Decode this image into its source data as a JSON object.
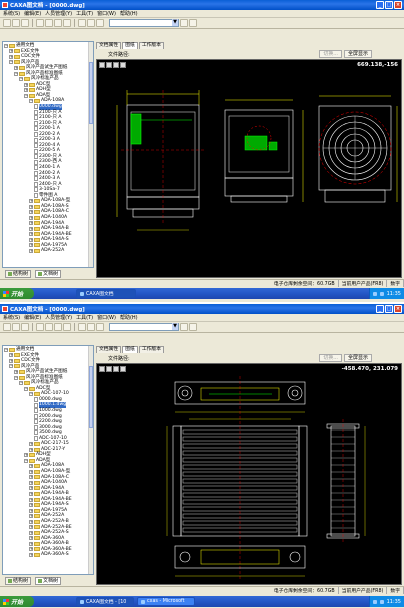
{
  "window1": {
    "title": "CAXA图文档 - [0000.dwg]",
    "menus": [
      "系统(S)",
      "编辑(E)",
      "人员管理(Y)",
      "工具(T)",
      "窗口(W)",
      "帮助(H)"
    ],
    "doc_tabs": [
      "文档属性",
      "图纸",
      "工作版本"
    ],
    "path_label": "文件路径:",
    "disabled_button": "切换...",
    "fullscreen_button": "全屏显示",
    "coordinate": "669.138,-156",
    "tree": [
      {
        "t": "通用文档",
        "d": 0,
        "k": "fold",
        "pm": "-"
      },
      {
        "t": "EXE文件",
        "d": 1,
        "k": "fold",
        "pm": "+"
      },
      {
        "t": "CDC文件",
        "d": 1,
        "k": "fold",
        "pm": "+"
      },
      {
        "t": "风冷产品",
        "d": 1,
        "k": "fold",
        "pm": "-"
      },
      {
        "t": "风冷产品试生产图纸",
        "d": 2,
        "k": "fold",
        "pm": "+"
      },
      {
        "t": "风冷产品标准图纸",
        "d": 2,
        "k": "fold",
        "pm": "-"
      },
      {
        "t": "风冷标准产品",
        "d": 3,
        "k": "fold",
        "pm": "-"
      },
      {
        "t": "ADC型",
        "d": 4,
        "k": "fold",
        "pm": "+"
      },
      {
        "t": "ADH型",
        "d": 4,
        "k": "fold",
        "pm": "+"
      },
      {
        "t": "ADA型",
        "d": 4,
        "k": "fold",
        "pm": "-"
      },
      {
        "t": "ADA-108A",
        "d": 5,
        "k": "fold",
        "pm": "-"
      },
      {
        "t": "0000.dwg",
        "d": 6,
        "k": "file",
        "sel": true
      },
      {
        "t": "2100-只 A",
        "d": 6,
        "k": "file"
      },
      {
        "t": "2100-只 A",
        "d": 6,
        "k": "file"
      },
      {
        "t": "2100-只 A",
        "d": 6,
        "k": "file"
      },
      {
        "t": "2200-1 A",
        "d": 6,
        "k": "file"
      },
      {
        "t": "2200-2 A",
        "d": 6,
        "k": "file"
      },
      {
        "t": "2200-3 A",
        "d": 6,
        "k": "file"
      },
      {
        "t": "2200-4 A",
        "d": 6,
        "k": "file"
      },
      {
        "t": "2200-5 A",
        "d": 6,
        "k": "file"
      },
      {
        "t": "2300-只 A",
        "d": 6,
        "k": "file"
      },
      {
        "t": "2300-西 A",
        "d": 6,
        "k": "file"
      },
      {
        "t": "2400-1 A",
        "d": 6,
        "k": "file"
      },
      {
        "t": "2400-2 A",
        "d": 6,
        "k": "file"
      },
      {
        "t": "2400-3 A",
        "d": 6,
        "k": "file"
      },
      {
        "t": "2400-只 A",
        "d": 6,
        "k": "file"
      },
      {
        "t": "3-10Sa-7",
        "d": 6,
        "k": "file"
      },
      {
        "t": "零件图 A",
        "d": 6,
        "k": "file"
      },
      {
        "t": "ADA-108A-型",
        "d": 5,
        "k": "fold",
        "pm": "+"
      },
      {
        "t": "ADA-108A-S",
        "d": 5,
        "k": "fold",
        "pm": "+"
      },
      {
        "t": "ADA-108A-C",
        "d": 5,
        "k": "fold",
        "pm": "+"
      },
      {
        "t": "ADA-1040A",
        "d": 5,
        "k": "fold",
        "pm": "+"
      },
      {
        "t": "ADA-194A",
        "d": 5,
        "k": "fold",
        "pm": "+"
      },
      {
        "t": "ADA-194A-B",
        "d": 5,
        "k": "fold",
        "pm": "+"
      },
      {
        "t": "ADA-194A-BE",
        "d": 5,
        "k": "fold",
        "pm": "+"
      },
      {
        "t": "ADA-194A-S",
        "d": 5,
        "k": "fold",
        "pm": "+"
      },
      {
        "t": "ADA-1975A",
        "d": 5,
        "k": "fold",
        "pm": "+"
      },
      {
        "t": "ADA-252A",
        "d": 5,
        "k": "fold",
        "pm": "+"
      }
    ],
    "left_tabs": [
      "结构树",
      "文档树"
    ],
    "status": [
      "电子仓库剩余空间：60.7GB",
      "当前用户产品(FR8)",
      "数字"
    ],
    "taskbar": {
      "start": "开始",
      "task": "CAXA图文档",
      "clock": "11:35"
    }
  },
  "window2": {
    "title": "CAXA图文档 - [0000.dwg]",
    "menus": [
      "系统(S)",
      "编辑(E)",
      "人员管理(Y)",
      "工具(T)",
      "窗口(W)",
      "帮助(H)"
    ],
    "doc_tabs": [
      "文档属性",
      "图纸",
      "工作版本"
    ],
    "path_label": "文件路径:",
    "disabled_button": "切换...",
    "fullscreen_button": "全屏显示",
    "coordinate": "-458.470, 231.079",
    "tree": [
      {
        "t": "通用文档",
        "d": 0,
        "k": "fold",
        "pm": "-"
      },
      {
        "t": "EXE文件",
        "d": 1,
        "k": "fold",
        "pm": "+"
      },
      {
        "t": "CDC文件",
        "d": 1,
        "k": "fold",
        "pm": "+"
      },
      {
        "t": "风冷产品",
        "d": 1,
        "k": "fold",
        "pm": "-"
      },
      {
        "t": "风冷产品试生产图纸",
        "d": 2,
        "k": "fold",
        "pm": "+"
      },
      {
        "t": "风冷产品标准图纸",
        "d": 2,
        "k": "fold",
        "pm": "-"
      },
      {
        "t": "风冷标准产品",
        "d": 3,
        "k": "fold",
        "pm": "-"
      },
      {
        "t": "ADC型",
        "d": 4,
        "k": "fold",
        "pm": "-"
      },
      {
        "t": "ADC-107-10",
        "d": 5,
        "k": "fold",
        "pm": "-"
      },
      {
        "t": "0000.dwg",
        "d": 6,
        "k": "file"
      },
      {
        "t": "1000.1.dwg",
        "d": 6,
        "k": "file",
        "sel": true
      },
      {
        "t": "1000.dwg",
        "d": 6,
        "k": "file"
      },
      {
        "t": "2000.dwg",
        "d": 6,
        "k": "file"
      },
      {
        "t": "2200.dwg",
        "d": 6,
        "k": "file"
      },
      {
        "t": "3000.dwg",
        "d": 6,
        "k": "file"
      },
      {
        "t": "3500.dwg",
        "d": 6,
        "k": "file"
      },
      {
        "t": "ADC-107-10",
        "d": 6,
        "k": "file"
      },
      {
        "t": "ADC-217-15",
        "d": 5,
        "k": "fold",
        "pm": "+"
      },
      {
        "t": "ADC-217-Y",
        "d": 5,
        "k": "fold",
        "pm": "+"
      },
      {
        "t": "ADH型",
        "d": 4,
        "k": "fold",
        "pm": "+"
      },
      {
        "t": "ADA型",
        "d": 4,
        "k": "fold",
        "pm": "-"
      },
      {
        "t": "ADA-108A",
        "d": 5,
        "k": "fold",
        "pm": "+"
      },
      {
        "t": "ADA-108A-型",
        "d": 5,
        "k": "fold",
        "pm": "+"
      },
      {
        "t": "ADA-108A-C",
        "d": 5,
        "k": "fold",
        "pm": "+"
      },
      {
        "t": "ADA-1040A",
        "d": 5,
        "k": "fold",
        "pm": "+"
      },
      {
        "t": "ADA-194A",
        "d": 5,
        "k": "fold",
        "pm": "+"
      },
      {
        "t": "ADA-194A-B",
        "d": 5,
        "k": "fold",
        "pm": "+"
      },
      {
        "t": "ADA-194A-BE",
        "d": 5,
        "k": "fold",
        "pm": "+"
      },
      {
        "t": "ADA-194A-S",
        "d": 5,
        "k": "fold",
        "pm": "+"
      },
      {
        "t": "ADA-1975A",
        "d": 5,
        "k": "fold",
        "pm": "+"
      },
      {
        "t": "ADA-252A",
        "d": 5,
        "k": "fold",
        "pm": "+"
      },
      {
        "t": "ADA-252A-B",
        "d": 5,
        "k": "fold",
        "pm": "+"
      },
      {
        "t": "ADA-252A-BE",
        "d": 5,
        "k": "fold",
        "pm": "+"
      },
      {
        "t": "ADA-252A-S",
        "d": 5,
        "k": "fold",
        "pm": "+"
      },
      {
        "t": "ADA-360A",
        "d": 5,
        "k": "fold",
        "pm": "+"
      },
      {
        "t": "ADA-360A-B",
        "d": 5,
        "k": "fold",
        "pm": "+"
      },
      {
        "t": "ADA-360A-BE",
        "d": 5,
        "k": "fold",
        "pm": "+"
      },
      {
        "t": "ADA-360A-S",
        "d": 5,
        "k": "fold",
        "pm": "+"
      }
    ],
    "left_tabs": [
      "结构树",
      "文档树"
    ],
    "status": [
      "电子仓库剩余空间：60.7GB",
      "当前用户产品(FR8)",
      "数字"
    ],
    "taskbar": {
      "start": "开始",
      "task": "CAXA图文档 - [10",
      "task2": "cxas - Microsoft",
      "clock": "11:35"
    }
  }
}
